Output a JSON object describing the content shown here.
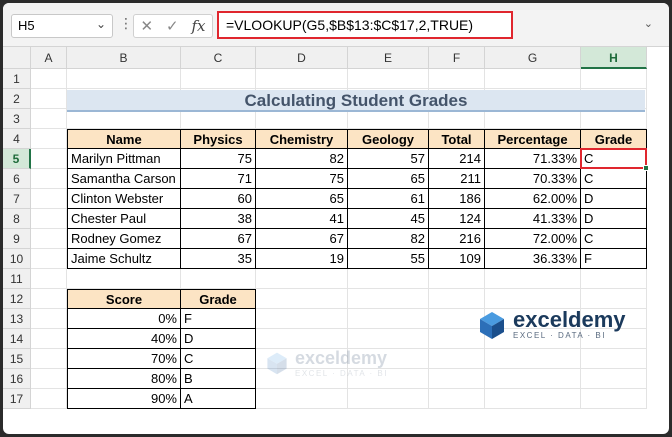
{
  "formula_bar": {
    "name_box": "H5",
    "formula": "=VLOOKUP(G5,$B$13:$C$17,2,TRUE)",
    "cancel_glyph": "✕",
    "enter_glyph": "✓",
    "fx_label": "fx"
  },
  "columns": [
    "A",
    "B",
    "C",
    "D",
    "E",
    "F",
    "G",
    "H"
  ],
  "rows": [
    "1",
    "2",
    "3",
    "4",
    "5",
    "6",
    "7",
    "8",
    "9",
    "10",
    "11",
    "12",
    "13",
    "14",
    "15",
    "16",
    "17"
  ],
  "title": "Calculating Student Grades",
  "student_table": {
    "headers": [
      "Name",
      "Physics",
      "Chemistry",
      "Geology",
      "Total",
      "Percentage",
      "Grade"
    ],
    "rows": [
      [
        "Marilyn Pittman",
        "75",
        "82",
        "57",
        "214",
        "71.33%",
        "C"
      ],
      [
        "Samantha Carson",
        "71",
        "75",
        "65",
        "211",
        "70.33%",
        "C"
      ],
      [
        "Clinton Webster",
        "60",
        "65",
        "61",
        "186",
        "62.00%",
        "D"
      ],
      [
        "Chester Paul",
        "38",
        "41",
        "45",
        "124",
        "41.33%",
        "D"
      ],
      [
        "Rodney Gomez",
        "67",
        "67",
        "82",
        "216",
        "72.00%",
        "C"
      ],
      [
        "Jaime Schultz",
        "35",
        "19",
        "55",
        "109",
        "36.33%",
        "F"
      ]
    ]
  },
  "score_table": {
    "headers": [
      "Score",
      "Grade"
    ],
    "rows": [
      [
        "0%",
        "F"
      ],
      [
        "40%",
        "D"
      ],
      [
        "70%",
        "C"
      ],
      [
        "80%",
        "B"
      ],
      [
        "90%",
        "A"
      ]
    ]
  },
  "logo": {
    "name": "exceldemy",
    "tagline": "EXCEL · DATA · BI"
  },
  "watermark": {
    "name": "exceldemy",
    "tagline": "EXCEL · DATA · BI"
  },
  "colors": {
    "accent_red": "#e0262e",
    "excel_green": "#217346",
    "table_header": "#fce4c4",
    "title_fill": "#dce6f1"
  }
}
